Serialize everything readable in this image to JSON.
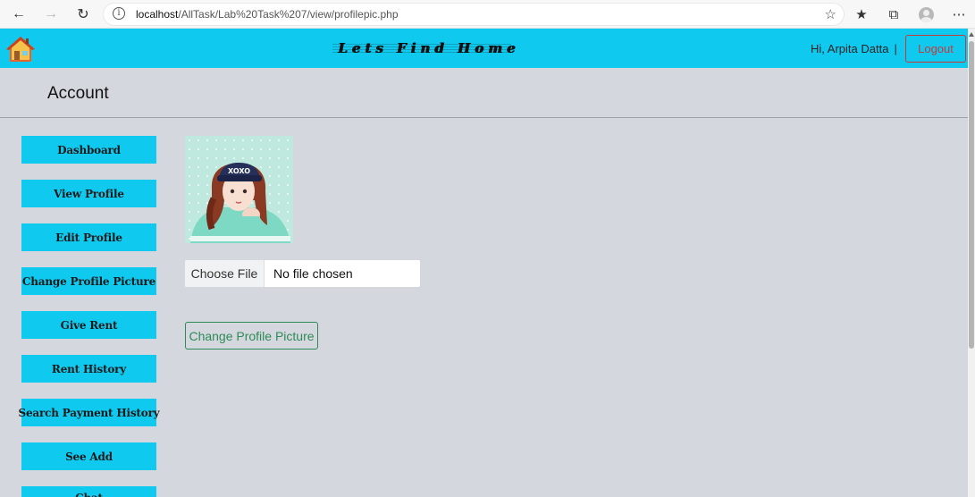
{
  "browser": {
    "url_host": "localhost",
    "url_path": "/AllTask/Lab%20Task%207/view/profilepic.php"
  },
  "header": {
    "site_title": "Lets Find Home",
    "greeting": "Hi, Arpita Datta",
    "separator": "|",
    "logout_label": "Logout"
  },
  "account": {
    "title": "Account"
  },
  "sidebar": {
    "items": [
      {
        "label": "Dashboard"
      },
      {
        "label": "View Profile"
      },
      {
        "label": "Edit Profile"
      },
      {
        "label": "Change Profile Picture"
      },
      {
        "label": "Give Rent"
      },
      {
        "label": "Rent History"
      },
      {
        "label": "Search Payment History"
      },
      {
        "label": "See Add"
      },
      {
        "label": "Chat"
      }
    ]
  },
  "main": {
    "file_choose_label": "Choose File",
    "file_status": "No file chosen",
    "submit_label": "Change Profile Picture"
  },
  "colors": {
    "header_bg": "#10c9ef",
    "page_bg": "#d4d7de",
    "logout": "#c53a3a",
    "submit": "#2e8b57"
  }
}
